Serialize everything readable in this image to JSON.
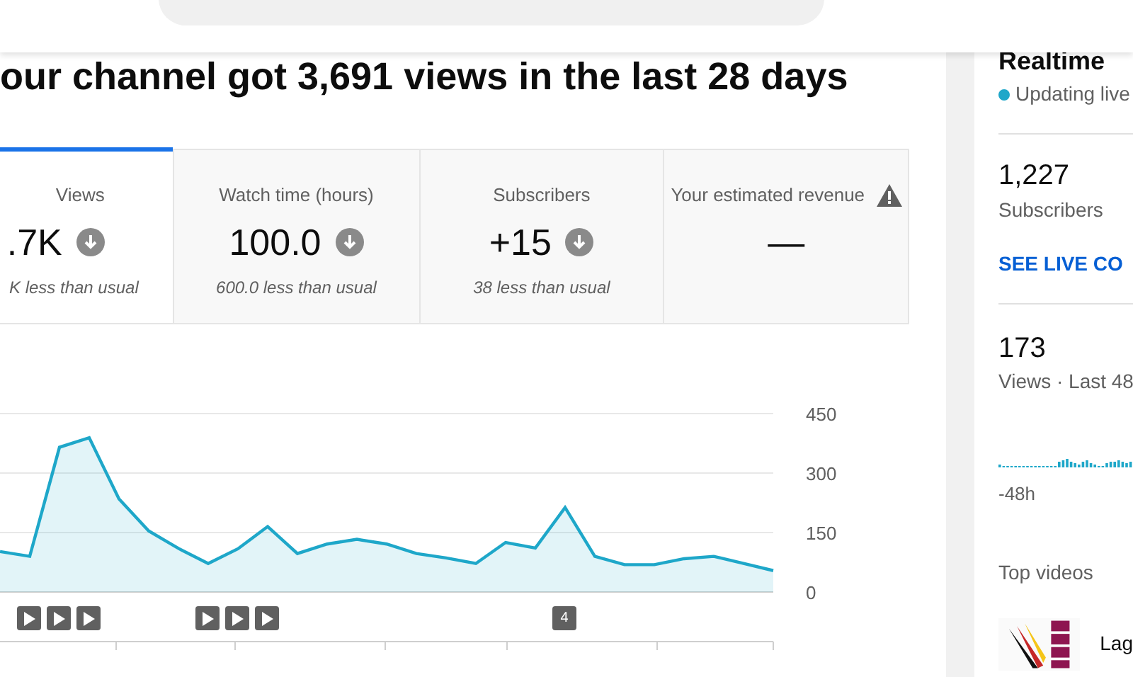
{
  "headline": "our channel got 3,691 views in the last 28 days",
  "metrics": [
    {
      "label": "Views",
      "value": ".7K",
      "kind": "down",
      "note": "K less than usual",
      "selected": true
    },
    {
      "label": "Watch time (hours)",
      "value": "100.0",
      "kind": "down",
      "note": "600.0 less than usual",
      "selected": false
    },
    {
      "label": "Subscribers",
      "value": "+15",
      "kind": "down",
      "note": "38 less than usual",
      "selected": false
    },
    {
      "label": "Your estimated revenue",
      "value": "—",
      "kind": "warning",
      "selected": false
    }
  ],
  "chart": {
    "chart_data": {
      "type": "area",
      "series": [
        {
          "color": "#1ea7c9",
          "values": [
            102,
            90,
            365,
            389,
            235,
            154,
            110,
            72,
            109,
            165,
            97,
            121,
            133,
            121,
            97,
            86,
            72,
            125,
            111,
            213,
            90,
            69,
            69,
            84,
            90,
            72,
            54
          ]
        }
      ],
      "ylim": [
        0,
        450
      ],
      "yticks": [
        0,
        150,
        300,
        450
      ]
    },
    "markers": [
      {
        "kind": "play"
      },
      {
        "kind": "play"
      },
      {
        "kind": "play"
      },
      {
        "kind": "play"
      },
      {
        "kind": "play"
      },
      {
        "kind": "play"
      },
      {
        "kind": "count",
        "label": "4"
      }
    ]
  },
  "realtime": {
    "title": "Realtime",
    "status": "Updating live",
    "subscribers": "1,227",
    "subscribers_label": "Subscribers",
    "link": "SEE LIVE CO",
    "views": "173",
    "views_label": "Views · Last 48",
    "axis_label": "-48h",
    "top_videos": "Top videos",
    "video_title": "Lag"
  }
}
